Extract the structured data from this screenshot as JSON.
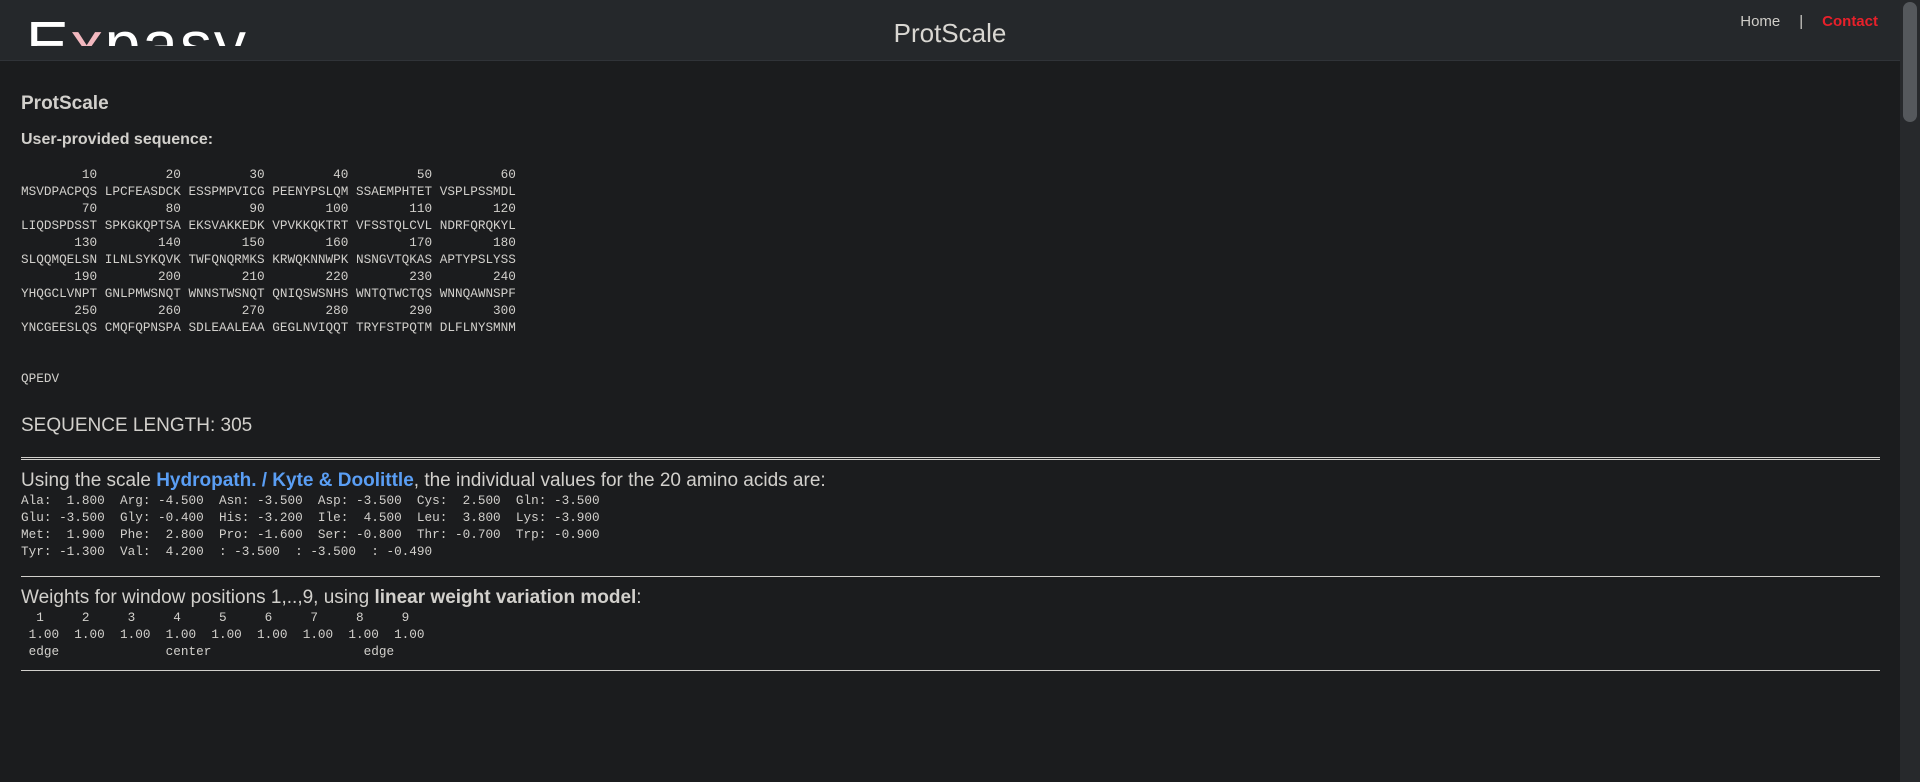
{
  "header": {
    "logo_text": "Expasy",
    "title": "ProtScale",
    "nav": {
      "home": "Home",
      "separator": "|",
      "contact": "Contact"
    }
  },
  "page": {
    "heading": "ProtScale",
    "sequence_label": "User-provided sequence:",
    "sequence_lines": [
      "        10         20         30         40         50         60\nMSVDPACPQS LPCFEASDCK ESSPMPVICG PEENYPSLQM SSAEMPHTET VSPLPSSMDL",
      "        70         80         90        100        110        120\nLIQDSPDSST SPKGKQPTSA EKSVAKKEDK VPVKKQKTRT VFSSTQLCVL NDRFQRQKYL",
      "       130        140        150        160        170        180\nSLQQMQELSN ILNLSYKQVK TWFQNQRMKS KRWQKNNWPK NSNGVTQKAS APTYPSLYSS",
      "       190        200        210        220        230        240\nYHQGCLVNPT GNLPMWSNQT WNNSTWSNQT QNIQSWSNHS WNTQTWCTQS WNNQAWNSPF",
      "       250        260        270        280        290        300\nYNCGEESLQS CMQFQPNSPA SDLEAALEAA GEGLNVIQQT TRYFSTPQTM DLFLNYSMNM",
      "\n\nQPEDV"
    ],
    "sequence_length_text": "SEQUENCE LENGTH: 305",
    "scale_intro_pre": "Using the scale ",
    "scale_name": "Hydropath. / Kyte & Doolittle",
    "scale_intro_post": ", the individual values for the 20 amino acids are:",
    "aa_values_text": "Ala:  1.800  Arg: -4.500  Asn: -3.500  Asp: -3.500  Cys:  2.500  Gln: -3.500\nGlu: -3.500  Gly: -0.400  His: -3.200  Ile:  4.500  Leu:  3.800  Lys: -3.900\nMet:  1.900  Phe:  2.800  Pro: -1.600  Ser: -0.800  Thr: -0.700  Trp: -0.900\nTyr: -1.300  Val:  4.200  : -3.500  : -3.500  : -0.490",
    "weights_intro_pre": "Weights for window positions 1,..,9, using ",
    "weights_model": "linear weight variation model",
    "weights_intro_post": ":",
    "weights_text": "  1     2     3     4     5     6     7     8     9\n 1.00  1.00  1.00  1.00  1.00  1.00  1.00  1.00  1.00\n edge              center                    edge"
  },
  "colors": {
    "background": "#1b1c1e",
    "header_bg": "#25282b",
    "text": "#d2d0cc",
    "link": "#5a9ef4",
    "contact": "#e8202a"
  }
}
